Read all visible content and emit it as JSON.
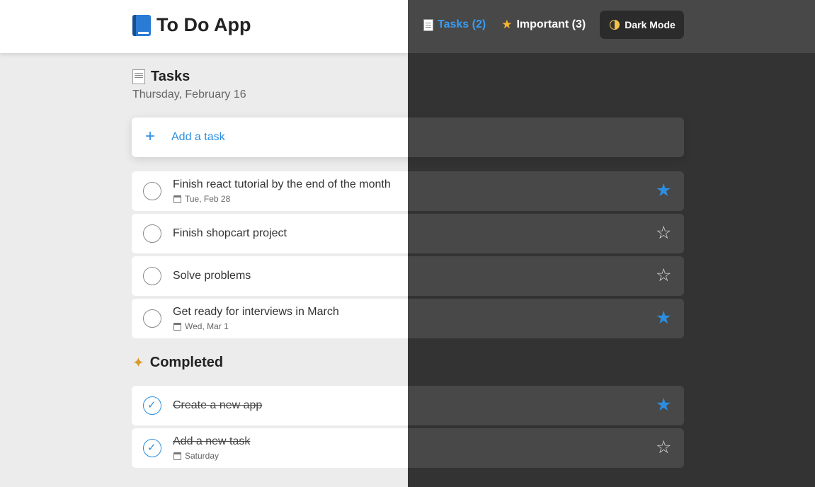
{
  "header": {
    "app_title": "To Do App",
    "nav": {
      "tasks_label": "Tasks (2)",
      "important_label": "Important (3)",
      "dark_mode_label": "Dark Mode"
    }
  },
  "tasks_section": {
    "title": "Tasks",
    "date": "Thursday, February 16",
    "add_task_label": "Add a task",
    "items": [
      {
        "text": "Finish react tutorial by the end of the month",
        "due": "Tue, Feb 28",
        "important": true
      },
      {
        "text": "Finish shopcart project",
        "due": "",
        "important": false
      },
      {
        "text": "Solve problems",
        "due": "",
        "important": false
      },
      {
        "text": "Get ready for interviews in March",
        "due": "Wed, Mar 1",
        "important": true
      }
    ]
  },
  "completed_section": {
    "title": "Completed",
    "items": [
      {
        "text": "Create a new app",
        "due": "",
        "important": true
      },
      {
        "text": "Add a new task",
        "due": "Saturday",
        "important": false
      }
    ]
  },
  "colors": {
    "accent": "#2c8ee0",
    "light_bg": "#ececec",
    "dark_bg": "#333333",
    "dark_card": "#484848",
    "star_gold": "#f5b82e"
  }
}
